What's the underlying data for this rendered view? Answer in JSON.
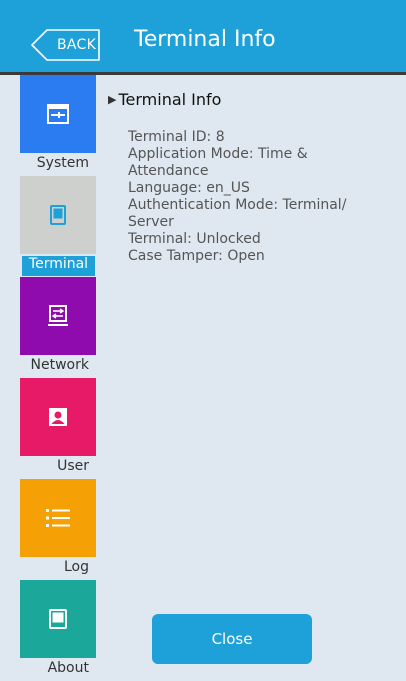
{
  "header": {
    "back_label": "BACK",
    "title": "Terminal Info",
    "background": "#1da1d8"
  },
  "sidebar": {
    "items": [
      {
        "label": "System",
        "icon": "system-settings-icon",
        "color": "#2a7cf0",
        "active": false
      },
      {
        "label": "Terminal",
        "icon": "terminal-device-icon",
        "color": "#cdd0cc",
        "active": true
      },
      {
        "label": "Network",
        "icon": "network-icon",
        "color": "#8f0bad",
        "active": false
      },
      {
        "label": "User",
        "icon": "user-icon",
        "color": "#e61a67",
        "active": false
      },
      {
        "label": "Log",
        "icon": "log-list-icon",
        "color": "#f5a005",
        "active": false
      },
      {
        "label": "About",
        "icon": "about-device-icon",
        "color": "#1ba89a",
        "active": false
      }
    ]
  },
  "main": {
    "section_title": "Terminal Info",
    "info_lines": [
      "Terminal ID: 8",
      "Application Mode: Time &",
      "Attendance",
      "Language: en_US",
      "Authentication Mode: Terminal/",
      "Server",
      "Terminal: Unlocked",
      "Case Tamper: Open"
    ]
  },
  "footer": {
    "close_label": "Close"
  }
}
